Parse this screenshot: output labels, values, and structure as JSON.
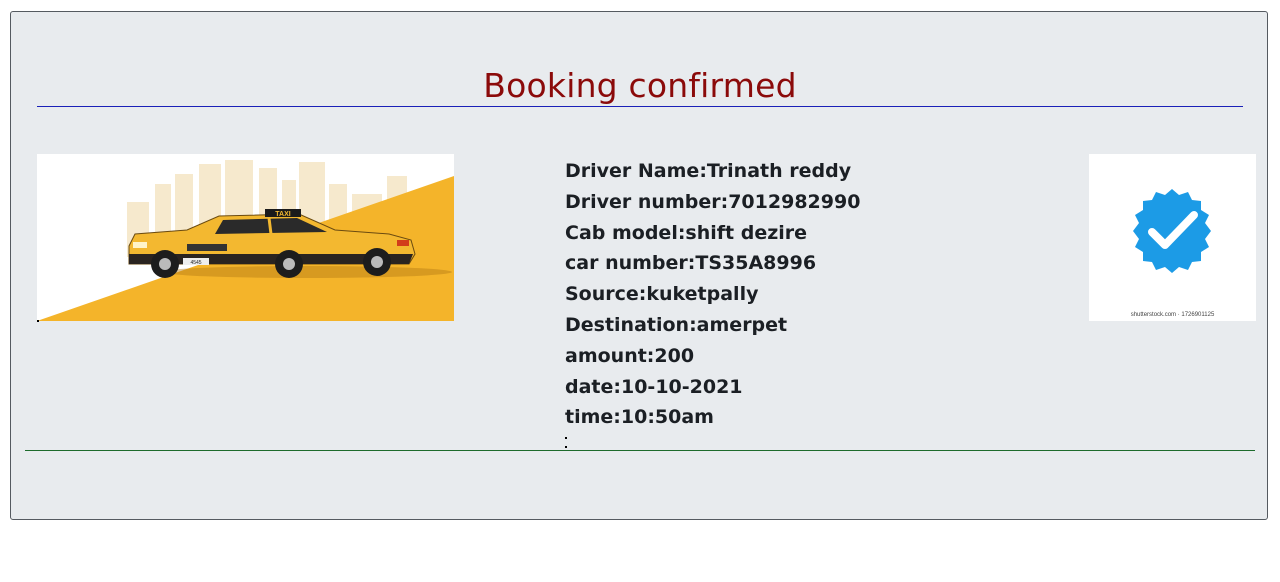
{
  "page": {
    "title": "Booking confirmed"
  },
  "booking": {
    "lines": [
      "Driver Name:Trinath reddy",
      "Driver number:7012982990",
      "Cab model:shift dezire",
      "car number:TS35A8996",
      "Source:kuketpally",
      "Destination:amerpet",
      "amount:200",
      "date:10-10-2021",
      "time:10:50am"
    ]
  },
  "images": {
    "taxi_plate": "4545",
    "taxi_sign": "TAXI",
    "verified_watermark": "shutterstock.com · 1726901125"
  },
  "colors": {
    "title": "#8b0a0a",
    "top_rule": "#1a20b8",
    "bottom_rule": "#1d6b2c",
    "card_bg": "#e8ebee",
    "taxi_yellow": "#f4b42a",
    "check_blue": "#1c9be6"
  }
}
